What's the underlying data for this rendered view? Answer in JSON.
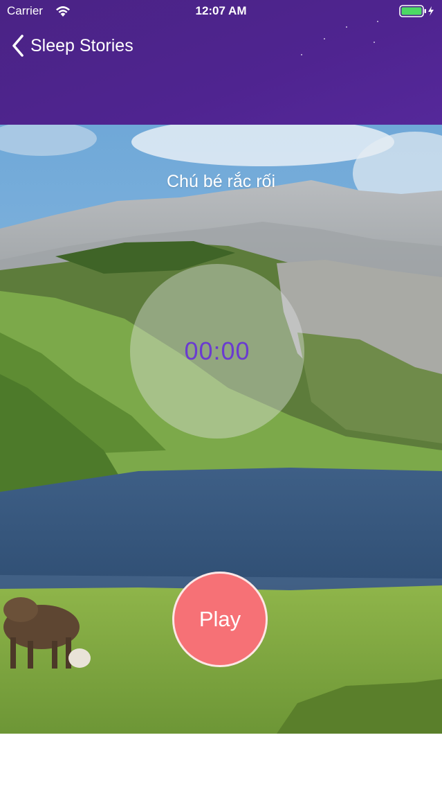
{
  "status_bar": {
    "carrier": "Carrier",
    "time": "12:07 AM"
  },
  "nav": {
    "back_label": "Sleep Stories"
  },
  "story": {
    "title": "Chú bé rắc rối"
  },
  "timer": {
    "value": "00:00"
  },
  "controls": {
    "play_label": "Play"
  },
  "colors": {
    "header": "#4f2490",
    "timer_text": "#6a3bd0",
    "play_button": "#f67176",
    "battery": "#4cd964"
  },
  "icons": [
    "wifi-icon",
    "battery-icon",
    "chevron-left-icon"
  ]
}
